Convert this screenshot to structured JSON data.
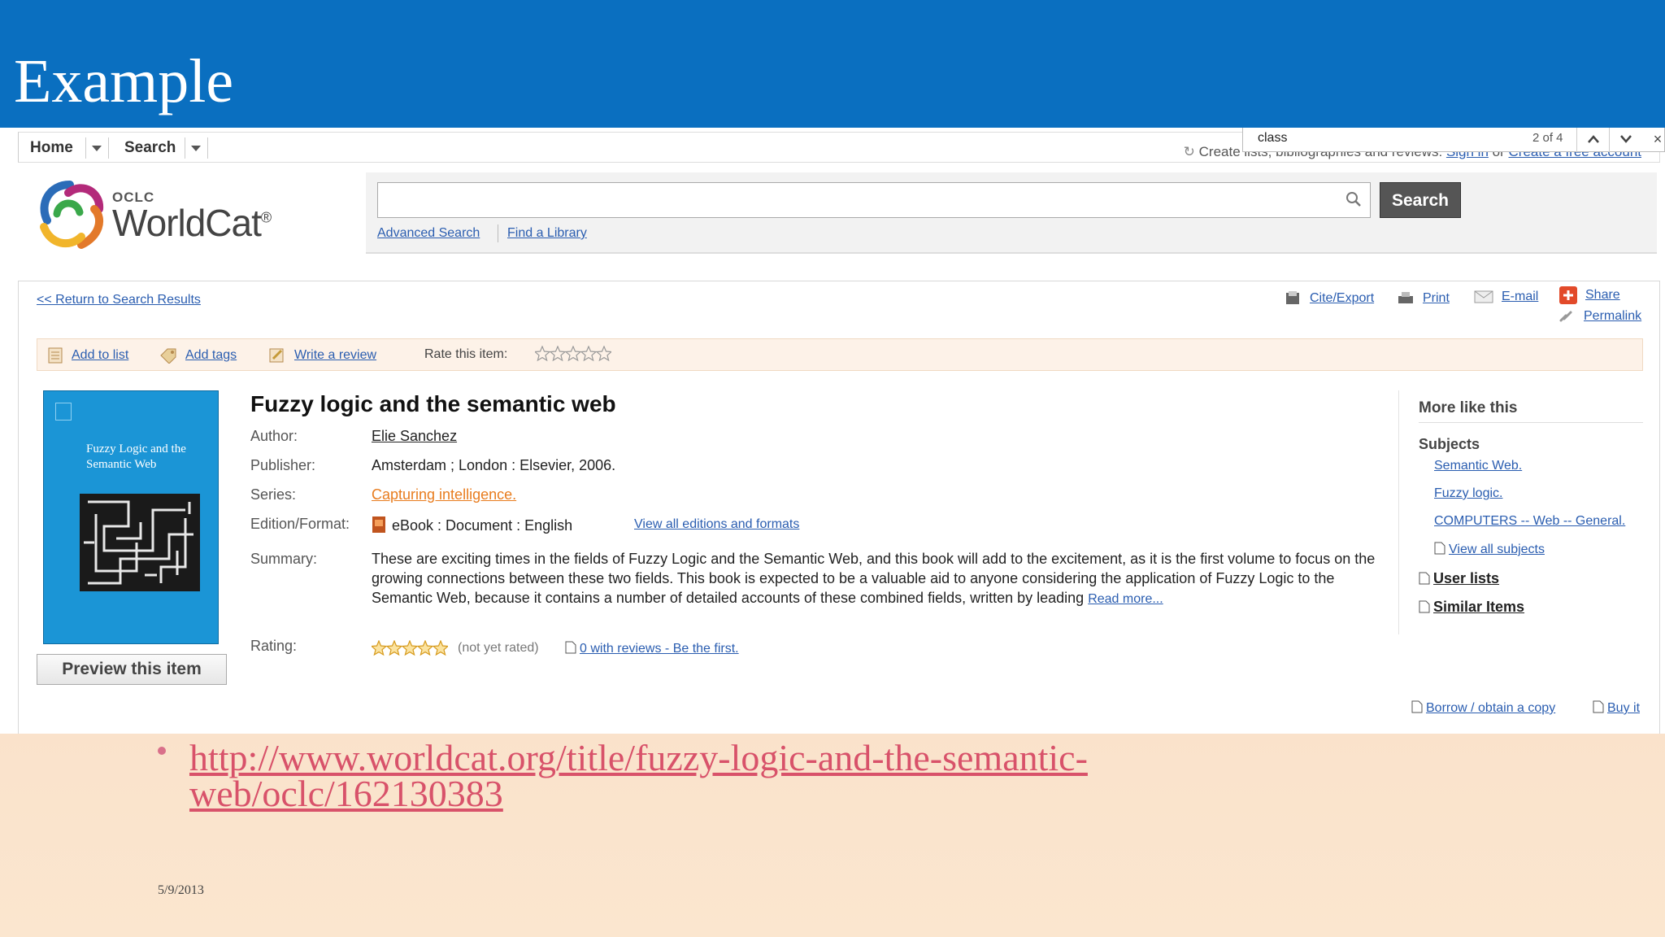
{
  "slide": {
    "title": "Example",
    "url_line1": "http://www.worldcat.org/title/fuzzy-logic-and-the-semantic-",
    "url_line2": "web/oclc/162130383",
    "date": "5/9/2013",
    "colors": {
      "header": "#0a6fc0",
      "link": "#d8526a"
    }
  },
  "nav": {
    "home": "Home",
    "search": "Search",
    "create_text": "Create lists, bibliographies and reviews:",
    "sign_in": "Sign in",
    "or": "or",
    "create_account": "Create a free account"
  },
  "findbar": {
    "query": "class",
    "count": "2 of 4",
    "up_icon": "chevron-up-icon",
    "down_icon": "chevron-down-icon",
    "close": "×"
  },
  "logo": {
    "oclc": "OCLC",
    "name": "WorldCat",
    "reg": "®"
  },
  "search": {
    "placeholder": "",
    "button": "Search",
    "advanced": "Advanced Search",
    "find_library": "Find a Library"
  },
  "record": {
    "return_link": "<< Return to Search Results",
    "tools": {
      "cite": "Cite/Export",
      "print": "Print",
      "email": "E-mail",
      "share": "Share",
      "permalink": "Permalink"
    },
    "actions": {
      "add_list": "Add to list",
      "add_tags": "Add tags",
      "write_review": "Write a review",
      "rate_label": "Rate this item:"
    },
    "title": "Fuzzy logic and the semantic web",
    "labels": {
      "author": "Author:",
      "publisher": "Publisher:",
      "series": "Series:",
      "edition": "Edition/Format:",
      "summary": "Summary:",
      "rating": "Rating:"
    },
    "author": "Elie Sanchez",
    "publisher": "Amsterdam ; London : Elsevier, 2006.",
    "series": "Capturing intelligence.",
    "edition": "eBook : Document : English",
    "view_editions": "View all editions and formats",
    "summary": "These are exciting times in the fields of Fuzzy Logic and the Semantic Web, and this book will add to the excitement, as it is the first volume to focus on the growing connections between these two fields. This book is expected to be a valuable aid to anyone considering the application of Fuzzy Logic to the Semantic Web, because it contains a number of detailed accounts of these combined fields, written by leading",
    "read_more": "Read more...",
    "rating_note": "(not yet rated)",
    "reviews": "0 with reviews - Be the first.",
    "preview": "Preview this item",
    "cover_title": "Fuzzy Logic and the Semantic Web"
  },
  "sidebar": {
    "heading": "More like this",
    "subjects_heading": "Subjects",
    "subjects": [
      "Semantic Web.",
      "Fuzzy logic.",
      "COMPUTERS -- Web -- General."
    ],
    "view_all": "View all subjects",
    "user_lists": "User lists",
    "similar": "Similar Items"
  },
  "bottom": {
    "borrow": "Borrow / obtain a copy",
    "buy": "Buy it"
  }
}
